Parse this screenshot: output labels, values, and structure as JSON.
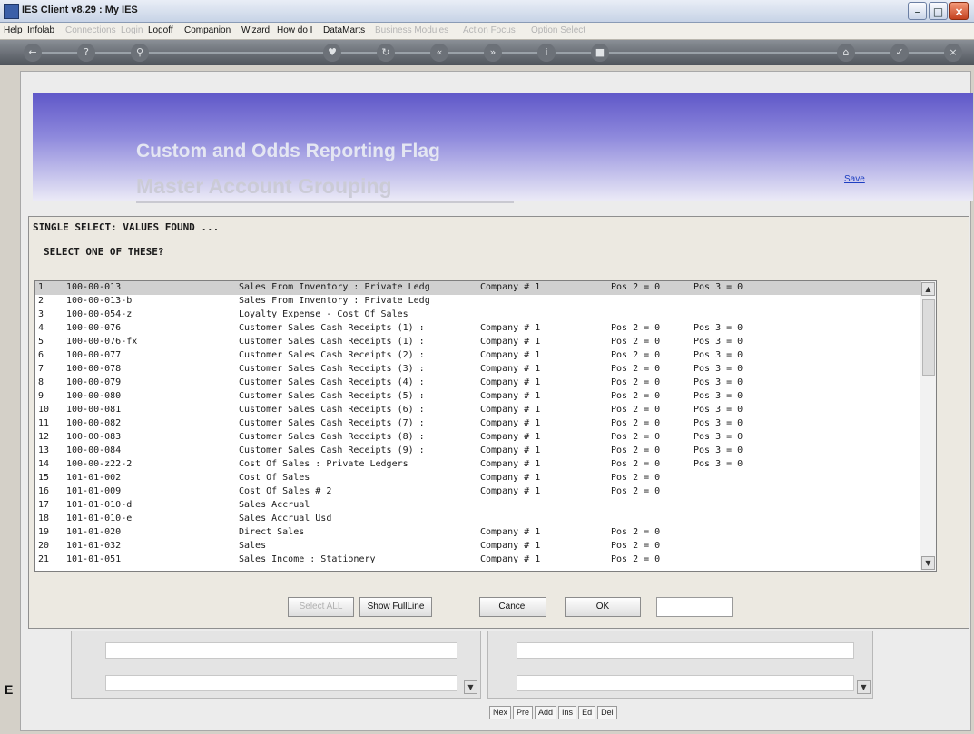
{
  "window": {
    "title": "IES Client v8.29 : My IES"
  },
  "menu": [
    {
      "label": "Help",
      "enabled": true
    },
    {
      "label": "Infolab",
      "enabled": true
    },
    {
      "label": "Connections",
      "enabled": false
    },
    {
      "label": "Login",
      "enabled": false
    },
    {
      "label": "Logoff",
      "enabled": true
    },
    {
      "label": "Companion",
      "enabled": true
    },
    {
      "label": "Wizard",
      "enabled": true
    },
    {
      "label": "How do I",
      "enabled": true
    },
    {
      "label": "DataMarts",
      "enabled": true
    },
    {
      "label": "Business Modules",
      "enabled": false
    },
    {
      "label": "Action Focus",
      "enabled": false
    },
    {
      "label": "Option Select",
      "enabled": false
    }
  ],
  "banner": {
    "title": "Custom and Odds Reporting Flag",
    "subtitle": "Master Account Grouping",
    "save_link": "Save"
  },
  "dialog": {
    "title": "SINGLE SELECT: VALUES FOUND ...",
    "prompt": "SELECT ONE OF THESE?",
    "rows": [
      {
        "n": "1",
        "code": "100-00-013",
        "desc": "Sales From Inventory : Private Ledg",
        "company": "Company # 1",
        "pos2": "Pos 2 = 0",
        "pos3": "Pos 3 = 0"
      },
      {
        "n": "2",
        "code": "100-00-013-b",
        "desc": "Sales From Inventory : Private Ledg",
        "company": "",
        "pos2": "",
        "pos3": ""
      },
      {
        "n": "3",
        "code": "100-00-054-z",
        "desc": "Loyalty Expense - Cost Of Sales",
        "company": "",
        "pos2": "",
        "pos3": ""
      },
      {
        "n": "4",
        "code": "100-00-076",
        "desc": "Customer Sales Cash Receipts (1) :",
        "company": "Company # 1",
        "pos2": "Pos 2 = 0",
        "pos3": "Pos 3 = 0"
      },
      {
        "n": "5",
        "code": "100-00-076-fx",
        "desc": "Customer Sales Cash Receipts (1) :",
        "company": "Company # 1",
        "pos2": "Pos 2 = 0",
        "pos3": "Pos 3 = 0"
      },
      {
        "n": "6",
        "code": "100-00-077",
        "desc": "Customer Sales Cash Receipts (2) :",
        "company": "Company # 1",
        "pos2": "Pos 2 = 0",
        "pos3": "Pos 3 = 0"
      },
      {
        "n": "7",
        "code": "100-00-078",
        "desc": "Customer Sales Cash Receipts (3) :",
        "company": "Company # 1",
        "pos2": "Pos 2 = 0",
        "pos3": "Pos 3 = 0"
      },
      {
        "n": "8",
        "code": "100-00-079",
        "desc": "Customer Sales Cash Receipts (4) :",
        "company": "Company # 1",
        "pos2": "Pos 2 = 0",
        "pos3": "Pos 3 = 0"
      },
      {
        "n": "9",
        "code": "100-00-080",
        "desc": "Customer Sales Cash Receipts (5) :",
        "company": "Company # 1",
        "pos2": "Pos 2 = 0",
        "pos3": "Pos 3 = 0"
      },
      {
        "n": "10",
        "code": "100-00-081",
        "desc": "Customer Sales Cash Receipts (6) :",
        "company": "Company # 1",
        "pos2": "Pos 2 = 0",
        "pos3": "Pos 3 = 0"
      },
      {
        "n": "11",
        "code": "100-00-082",
        "desc": "Customer Sales Cash Receipts (7) :",
        "company": "Company # 1",
        "pos2": "Pos 2 = 0",
        "pos3": "Pos 3 = 0"
      },
      {
        "n": "12",
        "code": "100-00-083",
        "desc": "Customer Sales Cash Receipts (8) :",
        "company": "Company # 1",
        "pos2": "Pos 2 = 0",
        "pos3": "Pos 3 = 0"
      },
      {
        "n": "13",
        "code": "100-00-084",
        "desc": "Customer Sales Cash Receipts (9) :",
        "company": "Company # 1",
        "pos2": "Pos 2 = 0",
        "pos3": "Pos 3 = 0"
      },
      {
        "n": "14",
        "code": "100-00-z22-2",
        "desc": "Cost Of Sales : Private Ledgers",
        "company": "Company # 1",
        "pos2": "Pos 2 = 0",
        "pos3": "Pos 3 = 0"
      },
      {
        "n": "15",
        "code": "101-01-002",
        "desc": "Cost Of Sales",
        "company": "Company # 1",
        "pos2": "Pos 2 = 0",
        "pos3": ""
      },
      {
        "n": "16",
        "code": "101-01-009",
        "desc": "Cost Of Sales # 2",
        "company": "Company # 1",
        "pos2": "Pos 2 = 0",
        "pos3": ""
      },
      {
        "n": "17",
        "code": "101-01-010-d",
        "desc": "Sales Accrual",
        "company": "",
        "pos2": "",
        "pos3": ""
      },
      {
        "n": "18",
        "code": "101-01-010-e",
        "desc": "Sales Accrual Usd",
        "company": "",
        "pos2": "",
        "pos3": ""
      },
      {
        "n": "19",
        "code": "101-01-020",
        "desc": "Direct Sales",
        "company": "Company # 1",
        "pos2": "Pos 2 = 0",
        "pos3": ""
      },
      {
        "n": "20",
        "code": "101-01-032",
        "desc": "Sales",
        "company": "Company # 1",
        "pos2": "Pos 2 = 0",
        "pos3": ""
      },
      {
        "n": "21",
        "code": "101-01-051",
        "desc": "Sales Income : Stationery",
        "company": "Company # 1",
        "pos2": "Pos 2 = 0",
        "pos3": ""
      }
    ],
    "buttons": {
      "select_all": "Select ALL",
      "show_full_line": "Show FullLine",
      "cancel": "Cancel",
      "ok": "OK"
    },
    "ok_field_value": ""
  },
  "nav_buttons": [
    "Nex",
    "Pre",
    "Add",
    "Ins",
    "Ed",
    "Del"
  ],
  "left_letter": "E"
}
